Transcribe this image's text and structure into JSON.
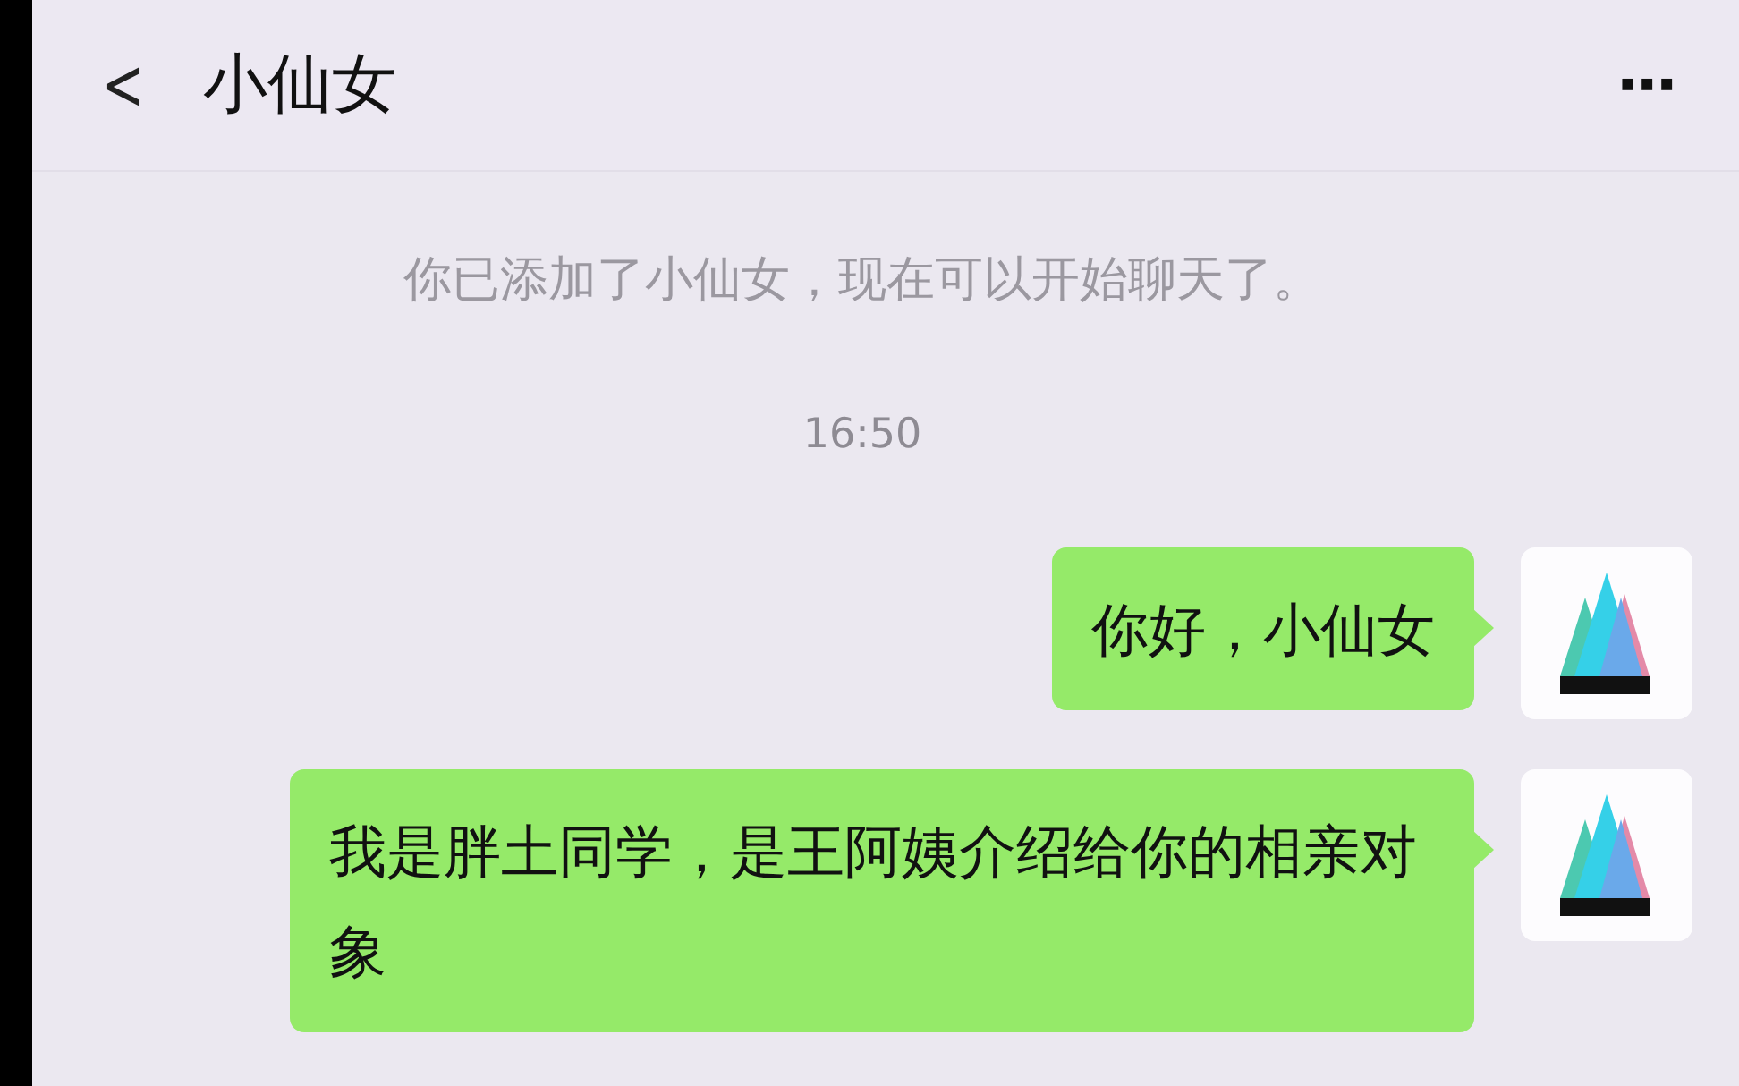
{
  "header": {
    "back": "<",
    "title": "小仙女",
    "more": "···"
  },
  "system_notice": "你已添加了小仙女，现在可以开始聊天了。",
  "time": "16:50",
  "messages": [
    {
      "kind": "outgoing",
      "text": "你好，小仙女"
    },
    {
      "kind": "outgoing",
      "text": "我是胖土同学，是王阿姨介绍给你的相亲对象"
    }
  ]
}
